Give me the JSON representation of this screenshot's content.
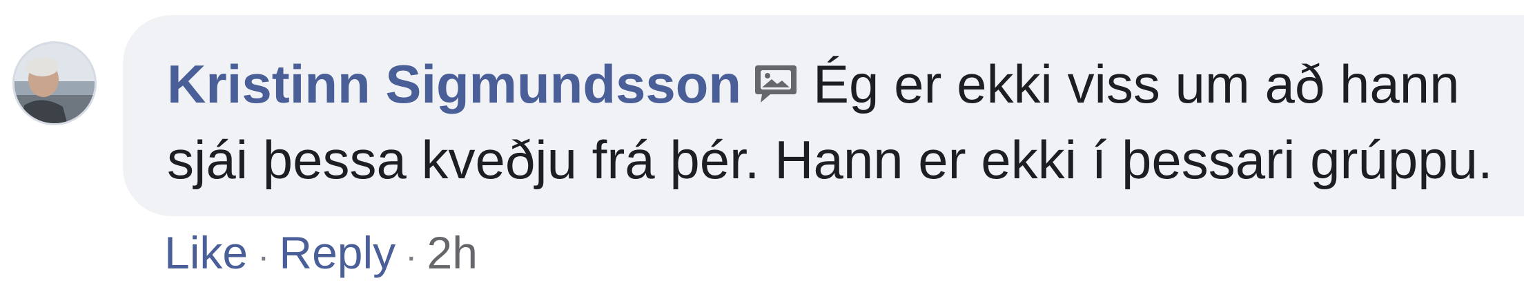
{
  "comment": {
    "author": "Kristinn Sigmundsson",
    "badge_icon": "image-comment-icon",
    "text": "Ég er ekki viss um að hann sjái þessa kveðju frá þér. Hann er ekki í þessari grúppu.",
    "colors": {
      "author": "#4a5f98",
      "text": "#1c1e21",
      "bubble": "#f0f2f5"
    }
  },
  "actions": {
    "like_label": "Like",
    "reply_label": "Reply",
    "separator": "·",
    "timestamp": "2h",
    "timestamp_color": "#65676b"
  }
}
